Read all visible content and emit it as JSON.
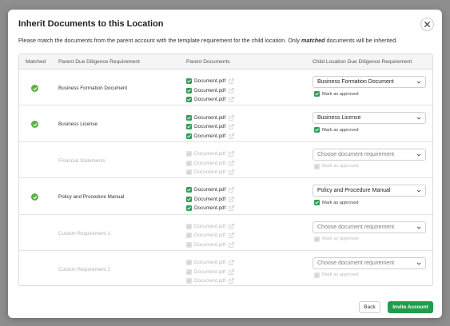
{
  "modal": {
    "title": "Inherit Documents to this Location",
    "subtitle_before": "Please match the documents from the parent account with the template requirement for the child location. Only ",
    "subtitle_emphasis": "matched",
    "subtitle_after": " documents will be inherited."
  },
  "table": {
    "headers": {
      "matched": "Matched",
      "parent_req": "Parent Due Diligence Requirement",
      "parent_docs": "Parent Documents",
      "child_req": "Child Location Due Diligence Requirement"
    },
    "rows": [
      {
        "matched": true,
        "requirement": "Business Formation Document",
        "documents": [
          "Document.pdf",
          "Document.pdf",
          "Document.pdf"
        ],
        "select_value": "Business Formation Document",
        "approved_label": "Mark as approved",
        "approved": true
      },
      {
        "matched": true,
        "requirement": "Business License",
        "documents": [
          "Document.pdf",
          "Document.pdf",
          "Document.pdf"
        ],
        "select_value": "Business License",
        "approved_label": "Mark as approved",
        "approved": true
      },
      {
        "matched": false,
        "requirement": "Financial Statements",
        "documents": [
          "Document.pdf",
          "Document.pdf",
          "Document.pdf"
        ],
        "select_value": "Choose document requirement",
        "approved_label": "Mark as approved",
        "approved": false
      },
      {
        "matched": true,
        "requirement": "Policy and Procedure Manual",
        "documents": [
          "Document.pdf",
          "Document.pdf",
          "Document.pdf"
        ],
        "select_value": "Policy and Procedure Manual",
        "approved_label": "Mark as approved",
        "approved": true
      },
      {
        "matched": false,
        "requirement": "Custom Requirement 1",
        "documents": [
          "Document.pdf",
          "Document.pdf",
          "Document.pdf"
        ],
        "select_value": "Choose document requirement",
        "approved_label": "Mark as approved",
        "approved": false
      },
      {
        "matched": false,
        "requirement": "Custom Requirement 2",
        "documents": [
          "Document.pdf",
          "Document.pdf",
          "Document.pdf"
        ],
        "select_value": "Choose document requirement",
        "approved_label": "Mark as approved",
        "approved": false
      }
    ]
  },
  "footer": {
    "back_label": "Back",
    "invite_label": "Invite Account"
  },
  "colors": {
    "accent": "#1f9d4b",
    "matched": "#5ab146"
  },
  "icons": {
    "close": "close-icon",
    "matched": "check-circle-icon",
    "doc_checkbox": "checkbox-icon",
    "external": "external-link-icon",
    "dropdown": "chevron-down-icon"
  }
}
